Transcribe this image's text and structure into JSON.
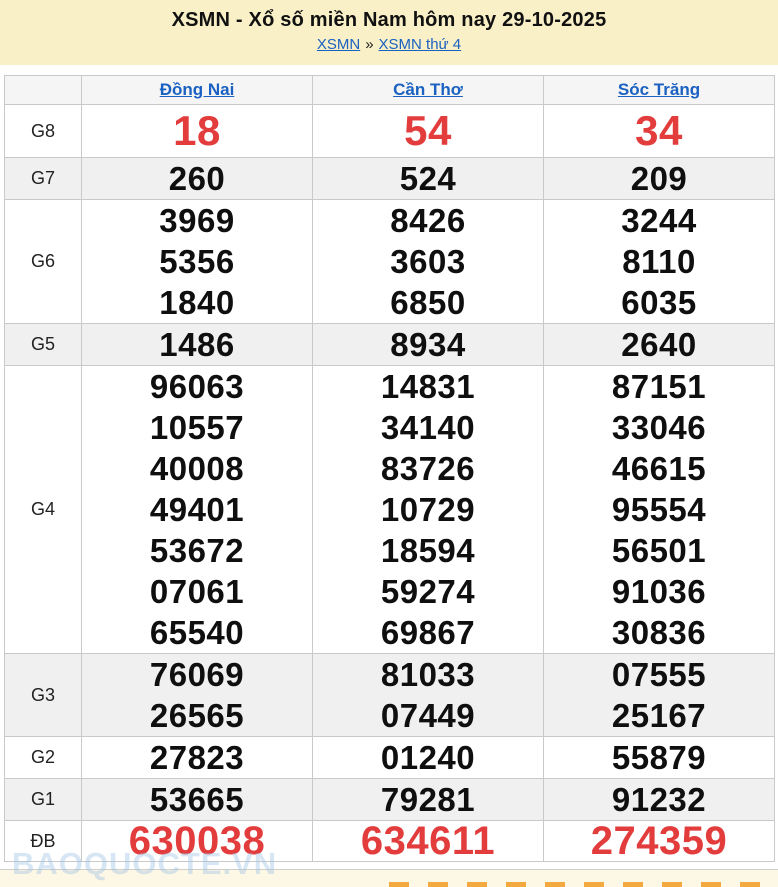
{
  "header": {
    "title": "XSMN - Xổ số miền Nam hôm nay 29-10-2025",
    "breadcrumb": {
      "link1": "XSMN",
      "separator": "»",
      "link2": "XSMN thứ 4"
    }
  },
  "table": {
    "columns": [
      "Đồng Nai",
      "Cần Thơ",
      "Sóc Trăng"
    ],
    "rows": [
      {
        "label": "G8",
        "shaded": false,
        "style": "red-large",
        "cells": [
          [
            "18"
          ],
          [
            "54"
          ],
          [
            "34"
          ]
        ]
      },
      {
        "label": "G7",
        "shaded": true,
        "style": "normal",
        "cells": [
          [
            "260"
          ],
          [
            "524"
          ],
          [
            "209"
          ]
        ]
      },
      {
        "label": "G6",
        "shaded": false,
        "style": "normal",
        "cells": [
          [
            "3969",
            "5356",
            "1840"
          ],
          [
            "8426",
            "3603",
            "6850"
          ],
          [
            "3244",
            "8110",
            "6035"
          ]
        ]
      },
      {
        "label": "G5",
        "shaded": true,
        "style": "normal",
        "cells": [
          [
            "1486"
          ],
          [
            "8934"
          ],
          [
            "2640"
          ]
        ]
      },
      {
        "label": "G4",
        "shaded": false,
        "style": "normal",
        "cells": [
          [
            "96063",
            "10557",
            "40008",
            "49401",
            "53672",
            "07061",
            "65540"
          ],
          [
            "14831",
            "34140",
            "83726",
            "10729",
            "18594",
            "59274",
            "69867"
          ],
          [
            "87151",
            "33046",
            "46615",
            "95554",
            "56501",
            "91036",
            "30836"
          ]
        ]
      },
      {
        "label": "G3",
        "shaded": true,
        "style": "normal",
        "cells": [
          [
            "76069",
            "26565"
          ],
          [
            "81033",
            "07449"
          ],
          [
            "07555",
            "25167"
          ]
        ]
      },
      {
        "label": "G2",
        "shaded": false,
        "style": "normal",
        "cells": [
          [
            "27823"
          ],
          [
            "01240"
          ],
          [
            "55879"
          ]
        ]
      },
      {
        "label": "G1",
        "shaded": true,
        "style": "normal",
        "cells": [
          [
            "53665"
          ],
          [
            "79281"
          ],
          [
            "91232"
          ]
        ]
      },
      {
        "label": "ĐB",
        "shaded": false,
        "style": "red-db",
        "cells": [
          [
            "630038"
          ],
          [
            "634611"
          ],
          [
            "274359"
          ]
        ]
      }
    ]
  },
  "watermark": "BAOQUOCTE.VN",
  "colors": {
    "banner_bg": "#faf0c8",
    "link_blue": "#1a61c1",
    "highlight_red": "#e23c3c",
    "row_alt_bg": "#f0f0f0",
    "strip_bg": "#fdf7e6",
    "strip_dash_orange": "#f2a93f"
  }
}
